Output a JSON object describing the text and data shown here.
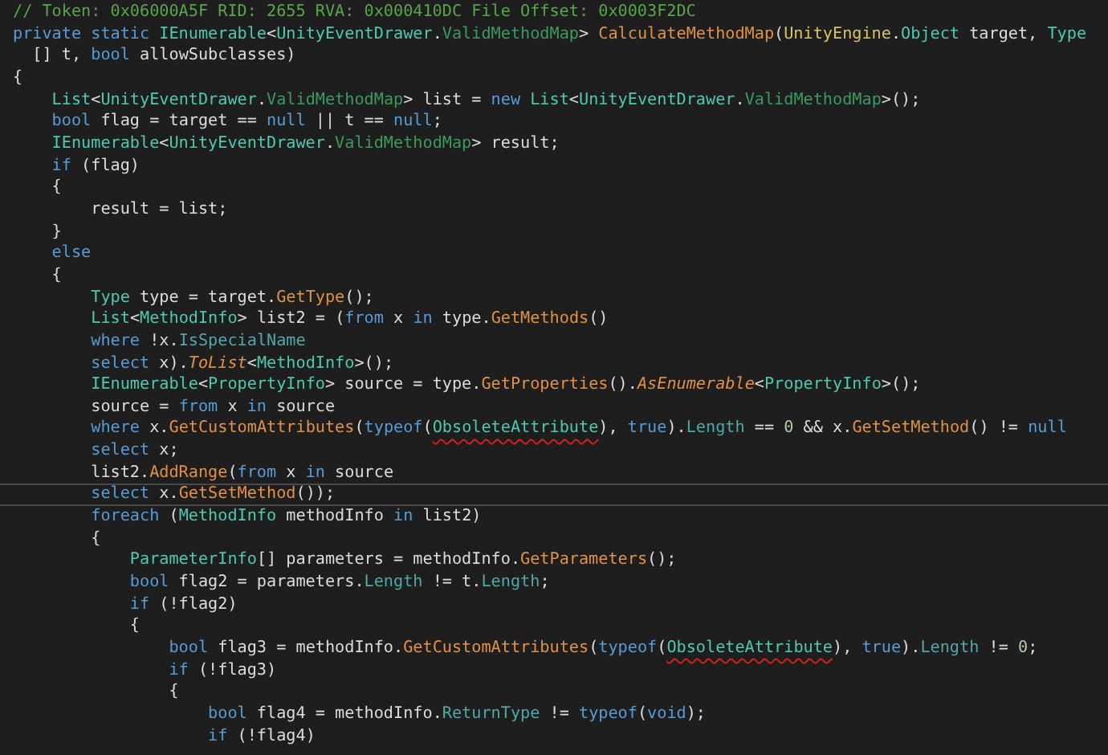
{
  "editor": {
    "lines": [
      {
        "current": false,
        "tokens": [
          {
            "kind": "comment",
            "text": "// Token: 0x06000A5F RID: 2655 RVA: 0x000410DC File Offset: 0x0003F2DC"
          }
        ]
      },
      {
        "current": false,
        "tokens": [
          {
            "kind": "keyword",
            "text": "private static "
          },
          {
            "kind": "type",
            "text": "IEnumerable"
          },
          {
            "kind": "plain",
            "text": "<"
          },
          {
            "kind": "type",
            "text": "UnityEventDrawer"
          },
          {
            "kind": "plain",
            "text": "."
          },
          {
            "kind": "nested",
            "text": "ValidMethodMap"
          },
          {
            "kind": "plain",
            "text": "> "
          },
          {
            "kind": "method",
            "text": "CalculateMethodMap"
          },
          {
            "kind": "plain",
            "text": "("
          },
          {
            "kind": "namespace",
            "text": "UnityEngine"
          },
          {
            "kind": "plain",
            "text": "."
          },
          {
            "kind": "type",
            "text": "Object"
          },
          {
            "kind": "plain",
            "text": " target, "
          },
          {
            "kind": "type",
            "text": "Type"
          }
        ]
      },
      {
        "current": false,
        "tokens": [
          {
            "kind": "plain",
            "text": "  [] t, "
          },
          {
            "kind": "keyword",
            "text": "bool"
          },
          {
            "kind": "plain",
            "text": " allowSubclasses)"
          }
        ]
      },
      {
        "current": false,
        "tokens": [
          {
            "kind": "plain",
            "text": "{"
          }
        ]
      },
      {
        "current": false,
        "tokens": [
          {
            "kind": "type",
            "text": "    List"
          },
          {
            "kind": "plain",
            "text": "<"
          },
          {
            "kind": "type",
            "text": "UnityEventDrawer"
          },
          {
            "kind": "plain",
            "text": "."
          },
          {
            "kind": "nested",
            "text": "ValidMethodMap"
          },
          {
            "kind": "plain",
            "text": "> list = "
          },
          {
            "kind": "keyword",
            "text": "new "
          },
          {
            "kind": "type",
            "text": "List"
          },
          {
            "kind": "plain",
            "text": "<"
          },
          {
            "kind": "type",
            "text": "UnityEventDrawer"
          },
          {
            "kind": "plain",
            "text": "."
          },
          {
            "kind": "nested",
            "text": "ValidMethodMap"
          },
          {
            "kind": "plain",
            "text": ">();"
          }
        ]
      },
      {
        "current": false,
        "tokens": [
          {
            "kind": "keyword",
            "text": "    bool"
          },
          {
            "kind": "plain",
            "text": " flag = target == "
          },
          {
            "kind": "keyword",
            "text": "null"
          },
          {
            "kind": "plain",
            "text": " || t == "
          },
          {
            "kind": "keyword",
            "text": "null"
          },
          {
            "kind": "plain",
            "text": ";"
          }
        ]
      },
      {
        "current": false,
        "tokens": [
          {
            "kind": "type",
            "text": "    IEnumerable"
          },
          {
            "kind": "plain",
            "text": "<"
          },
          {
            "kind": "type",
            "text": "UnityEventDrawer"
          },
          {
            "kind": "plain",
            "text": "."
          },
          {
            "kind": "nested",
            "text": "ValidMethodMap"
          },
          {
            "kind": "plain",
            "text": "> result;"
          }
        ]
      },
      {
        "current": false,
        "tokens": [
          {
            "kind": "keyword",
            "text": "    if"
          },
          {
            "kind": "plain",
            "text": " (flag)"
          }
        ]
      },
      {
        "current": false,
        "tokens": [
          {
            "kind": "plain",
            "text": "    {"
          }
        ]
      },
      {
        "current": false,
        "tokens": [
          {
            "kind": "plain",
            "text": "        result = list;"
          }
        ]
      },
      {
        "current": false,
        "tokens": [
          {
            "kind": "plain",
            "text": "    }"
          }
        ]
      },
      {
        "current": false,
        "tokens": [
          {
            "kind": "keyword",
            "text": "    else"
          }
        ]
      },
      {
        "current": false,
        "tokens": [
          {
            "kind": "plain",
            "text": "    {"
          }
        ]
      },
      {
        "current": false,
        "tokens": [
          {
            "kind": "type",
            "text": "        Type"
          },
          {
            "kind": "plain",
            "text": " type = target."
          },
          {
            "kind": "method",
            "text": "GetType"
          },
          {
            "kind": "plain",
            "text": "();"
          }
        ]
      },
      {
        "current": false,
        "tokens": [
          {
            "kind": "type",
            "text": "        List"
          },
          {
            "kind": "plain",
            "text": "<"
          },
          {
            "kind": "type",
            "text": "MethodInfo"
          },
          {
            "kind": "plain",
            "text": "> list2 = ("
          },
          {
            "kind": "keyword",
            "text": "from"
          },
          {
            "kind": "plain",
            "text": " x "
          },
          {
            "kind": "keyword",
            "text": "in"
          },
          {
            "kind": "plain",
            "text": " type."
          },
          {
            "kind": "method",
            "text": "GetMethods"
          },
          {
            "kind": "plain",
            "text": "()"
          }
        ]
      },
      {
        "current": false,
        "tokens": [
          {
            "kind": "keyword",
            "text": "        where"
          },
          {
            "kind": "plain",
            "text": " !x."
          },
          {
            "kind": "property",
            "text": "IsSpecialName"
          }
        ]
      },
      {
        "current": false,
        "tokens": [
          {
            "kind": "keyword",
            "text": "        select"
          },
          {
            "kind": "plain",
            "text": " x)."
          },
          {
            "kind": "extension",
            "text": "ToList"
          },
          {
            "kind": "plain",
            "text": "<"
          },
          {
            "kind": "type",
            "text": "MethodInfo"
          },
          {
            "kind": "plain",
            "text": ">();"
          }
        ]
      },
      {
        "current": false,
        "tokens": [
          {
            "kind": "type",
            "text": "        IEnumerable"
          },
          {
            "kind": "plain",
            "text": "<"
          },
          {
            "kind": "type",
            "text": "PropertyInfo"
          },
          {
            "kind": "plain",
            "text": "> source = type."
          },
          {
            "kind": "method",
            "text": "GetProperties"
          },
          {
            "kind": "plain",
            "text": "()."
          },
          {
            "kind": "extension",
            "text": "AsEnumerable"
          },
          {
            "kind": "plain",
            "text": "<"
          },
          {
            "kind": "type",
            "text": "PropertyInfo"
          },
          {
            "kind": "plain",
            "text": ">();"
          }
        ]
      },
      {
        "current": false,
        "tokens": [
          {
            "kind": "plain",
            "text": "        source = "
          },
          {
            "kind": "keyword",
            "text": "from"
          },
          {
            "kind": "plain",
            "text": " x "
          },
          {
            "kind": "keyword",
            "text": "in"
          },
          {
            "kind": "plain",
            "text": " source"
          }
        ]
      },
      {
        "current": false,
        "tokens": [
          {
            "kind": "keyword",
            "text": "        where"
          },
          {
            "kind": "plain",
            "text": " x."
          },
          {
            "kind": "method",
            "text": "GetCustomAttributes"
          },
          {
            "kind": "plain",
            "text": "("
          },
          {
            "kind": "keyword",
            "text": "typeof"
          },
          {
            "kind": "plain",
            "text": "("
          },
          {
            "kind": "marked",
            "text": "ObsoleteAttribute"
          },
          {
            "kind": "plain",
            "text": "), "
          },
          {
            "kind": "keyword",
            "text": "true"
          },
          {
            "kind": "plain",
            "text": ")."
          },
          {
            "kind": "property",
            "text": "Length"
          },
          {
            "kind": "plain",
            "text": " == "
          },
          {
            "kind": "number",
            "text": "0"
          },
          {
            "kind": "plain",
            "text": " && x."
          },
          {
            "kind": "method",
            "text": "GetSetMethod"
          },
          {
            "kind": "plain",
            "text": "() != "
          },
          {
            "kind": "keyword",
            "text": "null"
          }
        ]
      },
      {
        "current": false,
        "tokens": [
          {
            "kind": "keyword",
            "text": "        select"
          },
          {
            "kind": "plain",
            "text": " x;"
          }
        ]
      },
      {
        "current": false,
        "tokens": [
          {
            "kind": "plain",
            "text": "        list2."
          },
          {
            "kind": "method",
            "text": "AddRange"
          },
          {
            "kind": "plain",
            "text": "("
          },
          {
            "kind": "keyword",
            "text": "from"
          },
          {
            "kind": "plain",
            "text": " x "
          },
          {
            "kind": "keyword",
            "text": "in"
          },
          {
            "kind": "plain",
            "text": " source"
          }
        ]
      },
      {
        "current": true,
        "tokens": [
          {
            "kind": "keyword",
            "text": "        select"
          },
          {
            "kind": "plain",
            "text": " x."
          },
          {
            "kind": "method",
            "text": "GetSetMethod"
          },
          {
            "kind": "plain",
            "text": "());"
          }
        ]
      },
      {
        "current": false,
        "tokens": [
          {
            "kind": "keyword",
            "text": "        foreach"
          },
          {
            "kind": "plain",
            "text": " ("
          },
          {
            "kind": "type",
            "text": "MethodInfo"
          },
          {
            "kind": "plain",
            "text": " methodInfo "
          },
          {
            "kind": "keyword",
            "text": "in"
          },
          {
            "kind": "plain",
            "text": " list2)"
          }
        ]
      },
      {
        "current": false,
        "tokens": [
          {
            "kind": "plain",
            "text": "        {"
          }
        ]
      },
      {
        "current": false,
        "tokens": [
          {
            "kind": "type",
            "text": "            ParameterInfo"
          },
          {
            "kind": "plain",
            "text": "[] parameters = methodInfo."
          },
          {
            "kind": "method",
            "text": "GetParameters"
          },
          {
            "kind": "plain",
            "text": "();"
          }
        ]
      },
      {
        "current": false,
        "tokens": [
          {
            "kind": "keyword",
            "text": "            bool"
          },
          {
            "kind": "plain",
            "text": " flag2 = parameters."
          },
          {
            "kind": "property",
            "text": "Length"
          },
          {
            "kind": "plain",
            "text": " != t."
          },
          {
            "kind": "property",
            "text": "Length"
          },
          {
            "kind": "plain",
            "text": ";"
          }
        ]
      },
      {
        "current": false,
        "tokens": [
          {
            "kind": "keyword",
            "text": "            if"
          },
          {
            "kind": "plain",
            "text": " (!flag2)"
          }
        ]
      },
      {
        "current": false,
        "tokens": [
          {
            "kind": "plain",
            "text": "            {"
          }
        ]
      },
      {
        "current": false,
        "tokens": [
          {
            "kind": "keyword",
            "text": "                bool"
          },
          {
            "kind": "plain",
            "text": " flag3 = methodInfo."
          },
          {
            "kind": "method",
            "text": "GetCustomAttributes"
          },
          {
            "kind": "plain",
            "text": "("
          },
          {
            "kind": "keyword",
            "text": "typeof"
          },
          {
            "kind": "plain",
            "text": "("
          },
          {
            "kind": "marked",
            "text": "ObsoleteAttribute"
          },
          {
            "kind": "plain",
            "text": "), "
          },
          {
            "kind": "keyword",
            "text": "true"
          },
          {
            "kind": "plain",
            "text": ")."
          },
          {
            "kind": "property",
            "text": "Length"
          },
          {
            "kind": "plain",
            "text": " != "
          },
          {
            "kind": "number",
            "text": "0"
          },
          {
            "kind": "plain",
            "text": ";"
          }
        ]
      },
      {
        "current": false,
        "tokens": [
          {
            "kind": "keyword",
            "text": "                if"
          },
          {
            "kind": "plain",
            "text": " (!flag3)"
          }
        ]
      },
      {
        "current": false,
        "tokens": [
          {
            "kind": "plain",
            "text": "                {"
          }
        ]
      },
      {
        "current": false,
        "tokens": [
          {
            "kind": "keyword",
            "text": "                    bool"
          },
          {
            "kind": "plain",
            "text": " flag4 = methodInfo."
          },
          {
            "kind": "property",
            "text": "ReturnType"
          },
          {
            "kind": "plain",
            "text": " != "
          },
          {
            "kind": "keyword",
            "text": "typeof"
          },
          {
            "kind": "plain",
            "text": "("
          },
          {
            "kind": "keyword",
            "text": "void"
          },
          {
            "kind": "plain",
            "text": ");"
          }
        ]
      },
      {
        "current": false,
        "tokens": [
          {
            "kind": "keyword",
            "text": "                    if"
          },
          {
            "kind": "plain",
            "text": " (!flag4)"
          }
        ]
      }
    ]
  }
}
